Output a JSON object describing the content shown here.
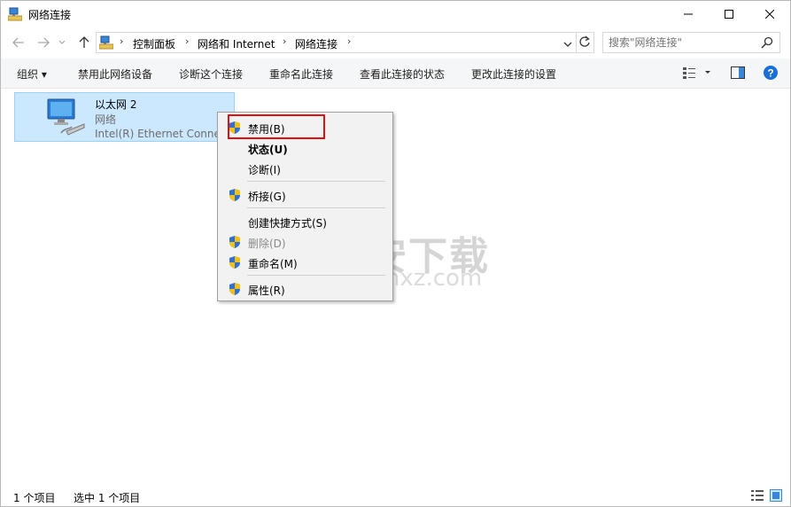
{
  "window": {
    "title": "网络连接",
    "minimize_symbol": "—",
    "maximize_symbol": "☐",
    "close_symbol": "✕"
  },
  "nav": {
    "back_icon": "arrow-left-icon",
    "forward_icon": "arrow-right-icon",
    "recent_icon": "chevron-down-icon",
    "up_icon": "arrow-up-icon"
  },
  "address": {
    "crumbs": [
      "控制面板",
      "网络和 Internet",
      "网络连接"
    ],
    "separator": "›"
  },
  "search": {
    "placeholder": "搜索\"网络连接\""
  },
  "toolbar": {
    "organize": "组织 ▾",
    "disable_device": "禁用此网络设备",
    "diagnose": "诊断这个连接",
    "rename": "重命名此连接",
    "view_status": "查看此连接的状态",
    "change_settings": "更改此连接的设置"
  },
  "connection": {
    "name": "以太网 2",
    "status": "网络",
    "adapter": "Intel(R) Ethernet Connection"
  },
  "context_menu": {
    "items": [
      {
        "label": "禁用(B)",
        "shield": true,
        "style": "normal"
      },
      {
        "label": "状态(U)",
        "shield": false,
        "style": "bold"
      },
      {
        "label": "诊断(I)",
        "shield": false,
        "style": "normal"
      },
      {
        "label": "桥接(G)",
        "shield": true,
        "style": "normal"
      },
      {
        "label": "创建快捷方式(S)",
        "shield": false,
        "style": "normal"
      },
      {
        "label": "删除(D)",
        "shield": true,
        "style": "disabled"
      },
      {
        "label": "重命名(M)",
        "shield": true,
        "style": "normal"
      },
      {
        "label": "属性(R)",
        "shield": true,
        "style": "normal"
      }
    ]
  },
  "watermark": {
    "text": "安下载",
    "sub": "anxz.com",
    "badge": "安"
  },
  "statusbar": {
    "count": "1 个项目",
    "selected": "选中 1 个项目"
  },
  "colors": {
    "selection_bg": "#cce8ff",
    "selection_border": "#99d1ff",
    "highlight_box": "#e01010",
    "shield_blue": "#2f6fd6",
    "shield_yellow": "#f4c20d",
    "help_blue": "#1a6fd6"
  }
}
